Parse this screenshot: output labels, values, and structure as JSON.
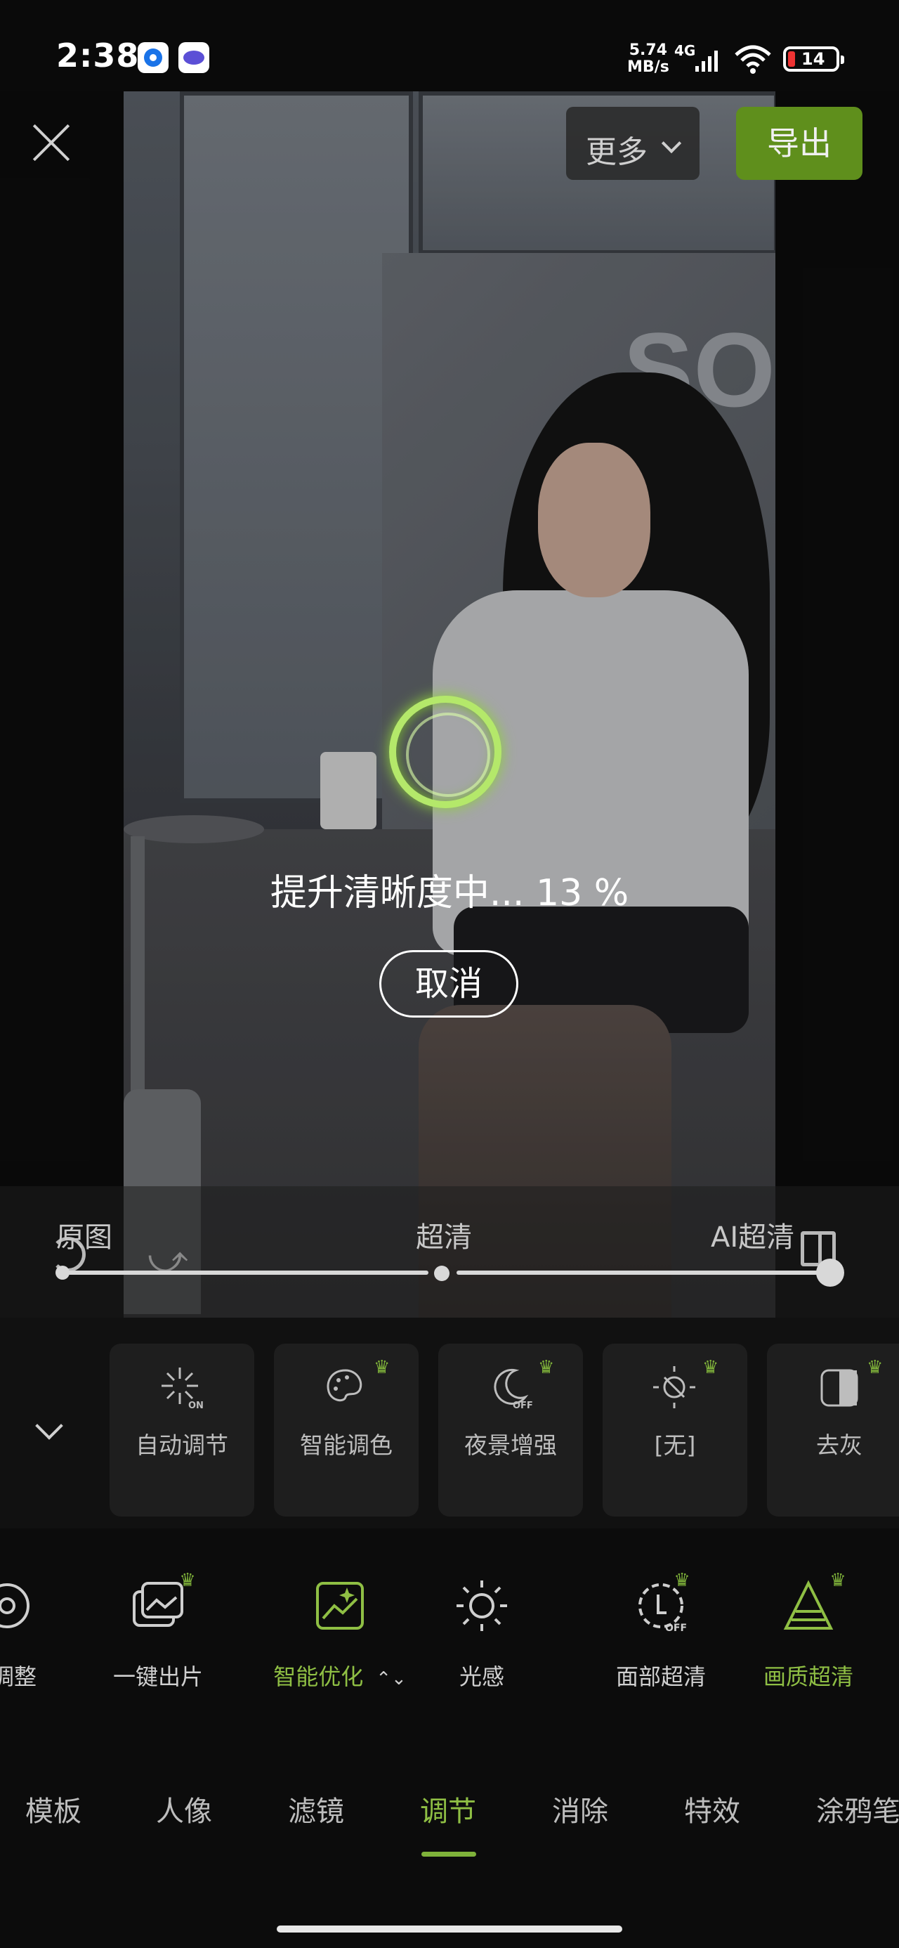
{
  "status_bar": {
    "time": "2:38",
    "net_speed_value": "5.74",
    "net_speed_unit": "MB/s",
    "signal_type": "4G",
    "battery": "14",
    "battery_color": "#e33333"
  },
  "photo": {
    "logo_text": "SO"
  },
  "header": {
    "more_label": "更多",
    "export_label": "导出",
    "export_color": "#5f8f1c"
  },
  "processing": {
    "status_text": "提升清晰度中... 13 %",
    "progress_percent": 13,
    "cancel_label": "取消"
  },
  "slider": {
    "labels": [
      "原图",
      "超清",
      "AI超清"
    ],
    "selected": "AI超清"
  },
  "sub_options": [
    {
      "label": "自动调节",
      "icon": "auto-adjust-icon",
      "badge": "ON"
    },
    {
      "label": "智能调色",
      "icon": "smart-color-icon",
      "premium": true
    },
    {
      "label": "夜景增强",
      "icon": "night-enhance-icon",
      "badge": "OFF",
      "premium": true
    },
    {
      "label": "[无]",
      "icon": "sun-slash-icon",
      "premium": true
    },
    {
      "label": "去灰",
      "icon": "dehaze-icon",
      "premium": true
    }
  ],
  "tools": [
    {
      "label": "调整",
      "icon": "adjust-icon"
    },
    {
      "label": "一键出片",
      "icon": "one-click-icon",
      "premium": true
    },
    {
      "label": "智能优化",
      "icon": "smart-optimize-icon",
      "active": true
    },
    {
      "label": "光感",
      "icon": "light-icon"
    },
    {
      "label": "面部超清",
      "icon": "face-hd-icon",
      "badge": "OFF",
      "premium": true
    },
    {
      "label": "画质超清",
      "icon": "quality-hd-icon",
      "active": true,
      "premium": true
    }
  ],
  "tabs": [
    "模板",
    "人像",
    "滤镜",
    "调节",
    "消除",
    "特效",
    "涂鸦笔"
  ],
  "active_tab": "调节",
  "accent_color": "#8fbf44"
}
